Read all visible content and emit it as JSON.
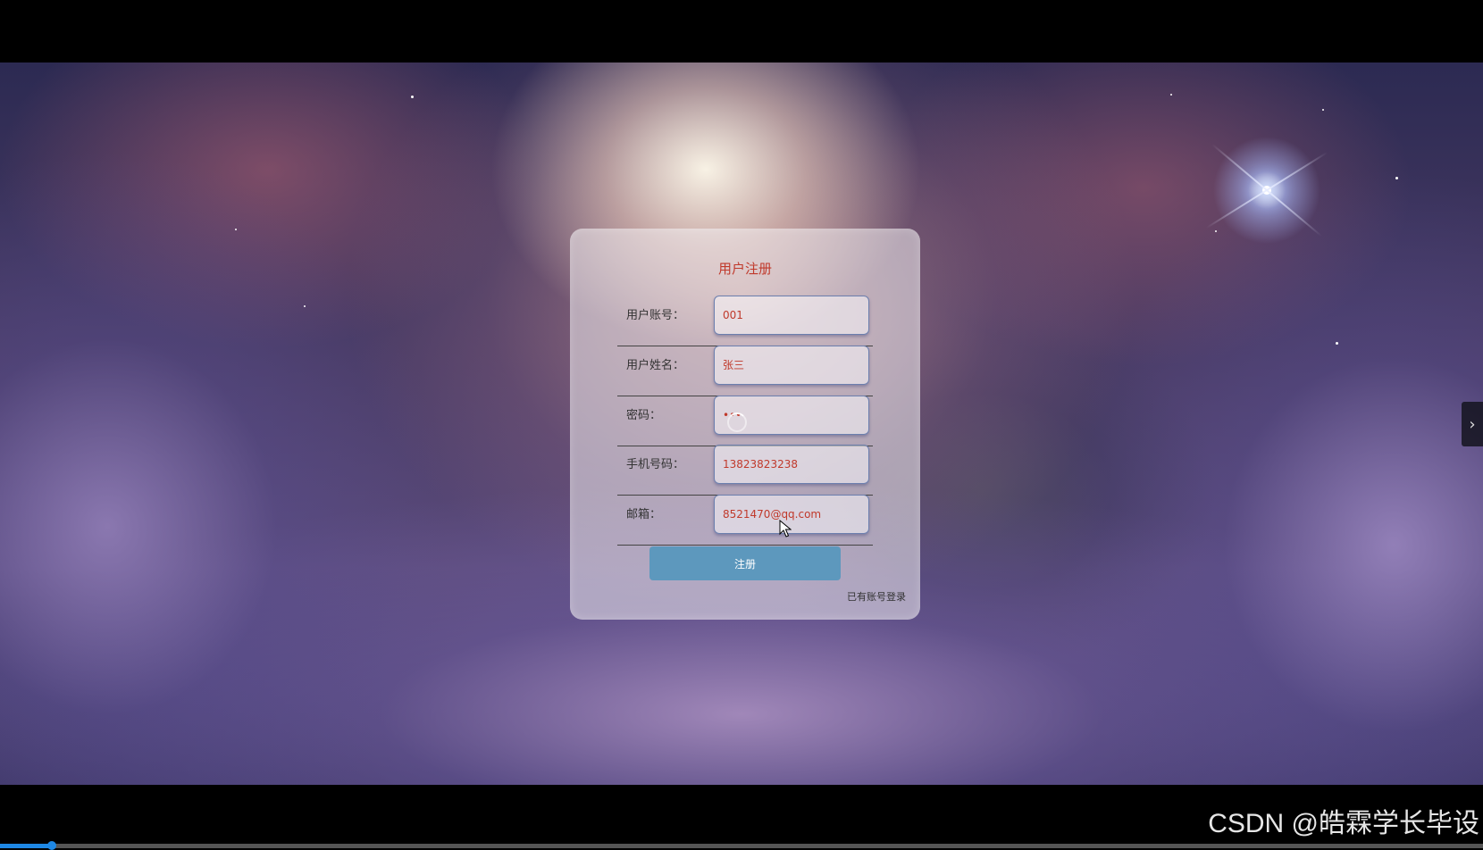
{
  "form": {
    "title": "用户注册",
    "fields": [
      {
        "label": "用户账号：",
        "value": "001"
      },
      {
        "label": "用户姓名：",
        "value": "张三"
      },
      {
        "label": "密码：",
        "value": "•••"
      },
      {
        "label": "手机号码：",
        "value": "13823823238"
      },
      {
        "label": "邮箱：",
        "value": "8521470@qq.com"
      }
    ],
    "submit_label": "注册",
    "login_link": "已有账号登录"
  },
  "watermark": "CSDN @皓霖学长毕设",
  "side_toggle_icon": "›",
  "video_progress": 0.035,
  "colors": {
    "accent_button": "#5d98bd",
    "title_red": "#c0392b",
    "progress_blue": "#1e88e5"
  }
}
